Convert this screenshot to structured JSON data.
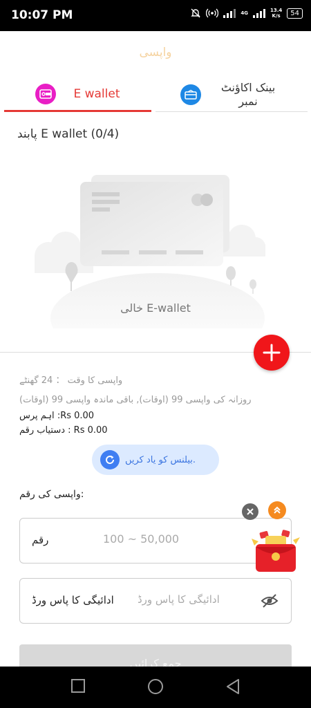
{
  "status_bar": {
    "time": "10:07 PM",
    "network_type": "4G",
    "speed_value": "13.4",
    "speed_unit": "K/s",
    "battery": "54"
  },
  "header": {
    "title": "واپسی"
  },
  "tabs": [
    {
      "label": "E wallet",
      "active": true
    },
    {
      "label": "بینک اکاؤنٹ نمبر",
      "active": false
    }
  ],
  "wallet": {
    "heading": "پابند E wallet (0/4)",
    "empty_label": "خالی E-wallet"
  },
  "info": {
    "withdraw_time": "واپسی کا وقت ： 24 گھنٹے",
    "daily_limit": "روزانہ کی واپسی 99 (اوقات), باقی ماندہ واپسی 99 (اوقات)",
    "main_balance": "اہم پرس :Rs 0.00",
    "available_amount": "دستیاب رقم : Rs 0.00"
  },
  "balance_button": {
    "label": "بیلنس کو یاد کریں."
  },
  "form": {
    "amount_section_label": "واپسی کی رقم:",
    "amount_label": "رقم",
    "amount_placeholder": "100 ~ 50,000",
    "password_label": "ادائیگی کا پاس ورڈ",
    "password_placeholder": "ادائیگی کا پاس ورڈ"
  },
  "submit": {
    "label": "جمع کرائیں"
  },
  "icons": {
    "ewallet_tab": "wallet-icon",
    "bank_tab": "bank-card-icon",
    "add": "plus-icon",
    "refresh": "refresh-icon",
    "password_visibility": "eye-off-icon",
    "close_float": "close-icon",
    "scroll_top": "double-chevron-up-icon",
    "promo": "red-envelope-gift-icon",
    "nav_recent": "square-icon",
    "nav_home": "circle-icon",
    "nav_back": "triangle-back-icon"
  },
  "colors": {
    "accent_red": "#e53935",
    "add_button": "#f0161a",
    "ewallet_icon": "#e91ec5",
    "bank_icon": "#1e88e5",
    "balance_button_bg": "#dceaff",
    "balance_button_text": "#3a74e0",
    "title_faded": "#f5d3a0"
  }
}
